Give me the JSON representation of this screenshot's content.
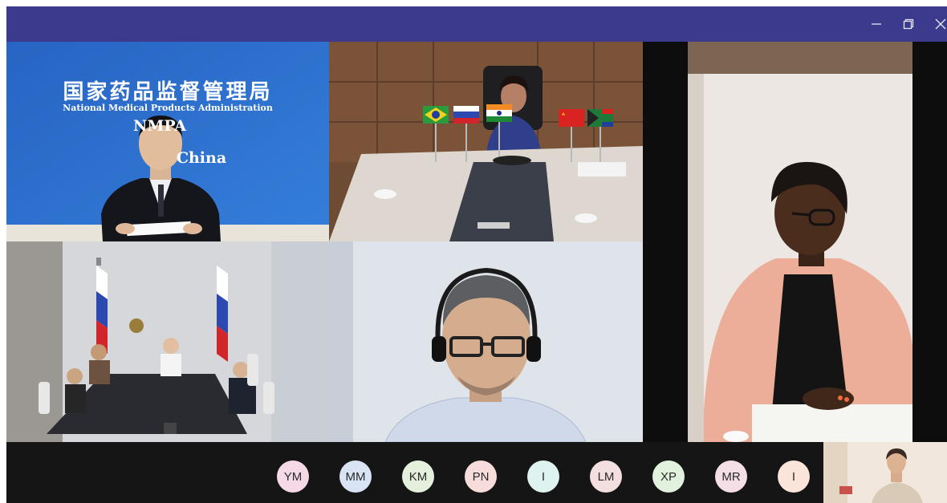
{
  "window": {
    "controls": [
      "minimize-icon",
      "restore-icon",
      "close-icon"
    ],
    "accent": "#3b3a8c"
  },
  "tiles": {
    "nmpa": {
      "banner_cn": "国家药品监督管理局",
      "banner_en": "National Medical Products Administration",
      "banner_abbr": "NMPA",
      "banner_country": "China"
    }
  },
  "participants": [
    {
      "initials": "YM",
      "color": "#f6d9e6"
    },
    {
      "initials": "MM",
      "color": "#d8e3f3"
    },
    {
      "initials": "KM",
      "color": "#e4f0dc"
    },
    {
      "initials": "PN",
      "color": "#f7dcdc"
    },
    {
      "initials": "I",
      "color": "#def2ef"
    },
    {
      "initials": "LM",
      "color": "#f3dee0"
    },
    {
      "initials": "XP",
      "color": "#e2f0de"
    },
    {
      "initials": "MR",
      "color": "#f5dfe6"
    },
    {
      "initials": "I",
      "color": "#fbe4da"
    }
  ]
}
